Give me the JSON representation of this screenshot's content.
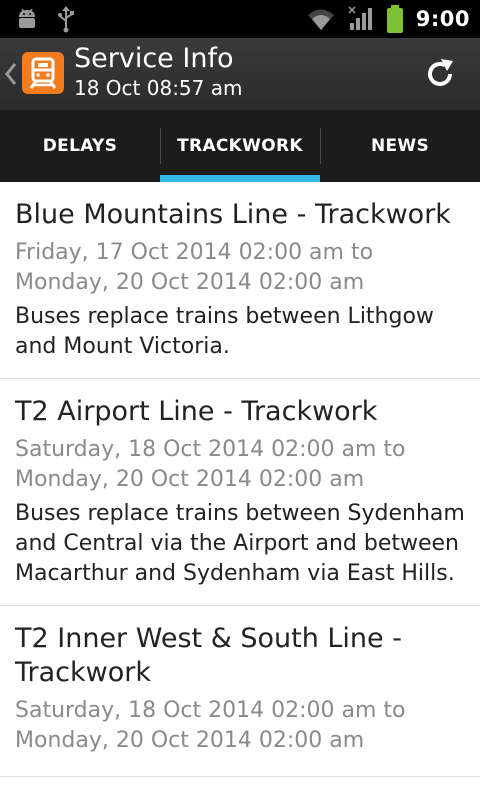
{
  "statusbar": {
    "time": "9:00",
    "icons": [
      "android-debug-icon",
      "usb-icon",
      "wifi-icon",
      "signal-icon",
      "battery-icon"
    ]
  },
  "actionbar": {
    "title": "Service Info",
    "subtitle": "18 Oct 08:57 am",
    "logo_color": "#f47c20",
    "refresh_icon": "refresh-icon"
  },
  "tabs": [
    {
      "label": "DELAYS",
      "selected": false
    },
    {
      "label": "TRACKWORK",
      "selected": true
    },
    {
      "label": "NEWS",
      "selected": false
    }
  ],
  "accent_color": "#33b5e5",
  "items": [
    {
      "title": "Blue Mountains Line - Trackwork",
      "date": "Friday, 17 Oct 2014 02:00 am to Monday, 20 Oct 2014 02:00 am",
      "description": "Buses replace trains between Lithgow and Mount Victoria."
    },
    {
      "title": "T2 Airport Line - Trackwork",
      "date": "Saturday, 18 Oct 2014 02:00 am to Monday, 20 Oct 2014 02:00 am",
      "description": "Buses replace trains between Sydenham and Central via the Airport and between Macarthur and Sydenham via East Hills."
    },
    {
      "title": "T2 Inner West & South Line - Trackwork",
      "date": "Saturday, 18 Oct 2014 02:00 am to Monday, 20 Oct 2014 02:00 am",
      "description": ""
    }
  ]
}
